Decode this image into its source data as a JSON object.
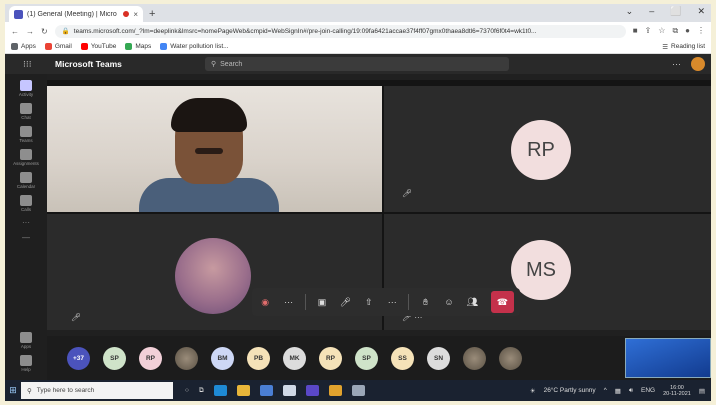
{
  "browser": {
    "tab_title": "(1) General (Meeting) | Micro",
    "new_tab": "+",
    "window_controls": [
      "⌄",
      "–",
      "⬜",
      "✕"
    ],
    "url": "teams.microsoft.com/_?lm=deeplink&lmsrc=homePageWeb&cmpid=WebSignIn#/pre-join-calling/19:09fa6421accae37f4ff07gmx0thaea8dtl6=7370f6f0t4=wk1t0...",
    "bookmarks": [
      {
        "label": "Apps",
        "color": "#5f6368"
      },
      {
        "label": "Gmail",
        "color": "#ea4335"
      },
      {
        "label": "YouTube",
        "color": "#ff0000"
      },
      {
        "label": "Maps",
        "color": "#34a853"
      },
      {
        "label": "Water pollution list...",
        "color": "#4285f4"
      }
    ],
    "reading_list": "Reading list"
  },
  "teams": {
    "app_name": "Microsoft Teams",
    "search_placeholder": "Search",
    "more": "···",
    "rail": [
      {
        "label": "Activity",
        "active": true
      },
      {
        "label": "Chat",
        "active": false
      },
      {
        "label": "Teams",
        "active": false
      },
      {
        "label": "Assignments",
        "active": false
      },
      {
        "label": "Calendar",
        "active": false
      },
      {
        "label": "Calls",
        "active": false
      }
    ],
    "rail_bottom": [
      "Apps",
      "Help"
    ]
  },
  "tiles": [
    {
      "type": "video",
      "name": ""
    },
    {
      "type": "initials",
      "initials": "RP",
      "color": "#f2dede"
    },
    {
      "type": "photo",
      "name": ""
    },
    {
      "type": "initials",
      "initials": "MS",
      "color": "#f2dede"
    }
  ],
  "controls": {
    "more_label": "···",
    "icons": [
      "record-icon",
      "more-icon",
      "camera-icon",
      "mic-icon",
      "share-icon",
      "more-actions-icon",
      "raise-hand-icon",
      "reactions-icon",
      "people-icon"
    ]
  },
  "participants": [
    {
      "label": "+37",
      "color": "#4b53bc"
    },
    {
      "label": "SP",
      "color": "#cfe3c9"
    },
    {
      "label": "RP",
      "color": "#f2d0d8"
    },
    {
      "label": "",
      "color": "photo"
    },
    {
      "label": "BM",
      "color": "#cdd7f5"
    },
    {
      "label": "PB",
      "color": "#f5e2b8"
    },
    {
      "label": "MK",
      "color": "#dcdcdc"
    },
    {
      "label": "RP",
      "color": "#f5e2b8"
    },
    {
      "label": "SP",
      "color": "#cfe3c9"
    },
    {
      "label": "SS",
      "color": "#f5e2b8"
    },
    {
      "label": "SN",
      "color": "#dcdcdc"
    },
    {
      "label": "",
      "color": "photo"
    },
    {
      "label": "",
      "color": "photo"
    }
  ],
  "taskbar": {
    "search_placeholder": "Type here to search",
    "weather": "26°C Partly sunny",
    "lang": "ENG",
    "time": "16:00",
    "date": "20-11-2021"
  }
}
